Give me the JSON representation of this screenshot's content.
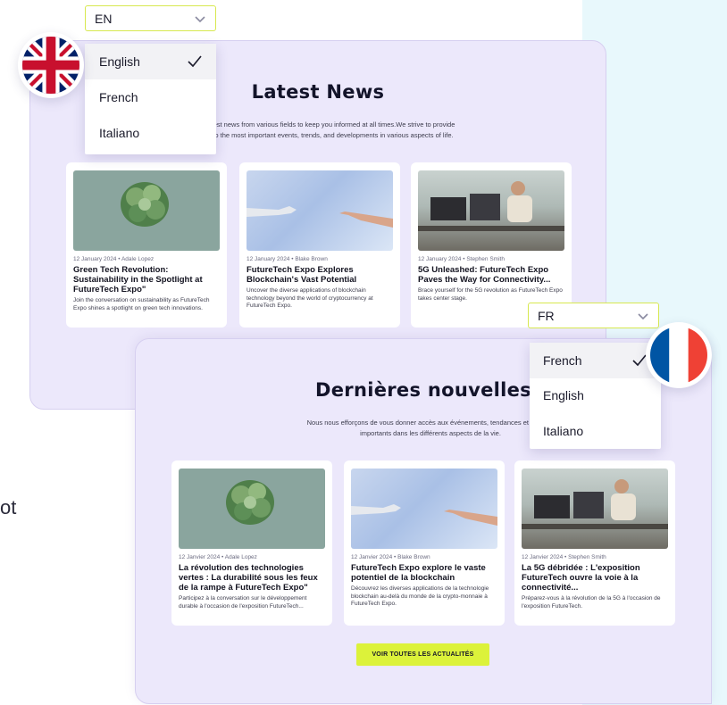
{
  "colors": {
    "accent": "#dcf23a",
    "panel_bg": "#ece8fb",
    "select_border": "#d7e84f",
    "uk_blue": "#012169",
    "uk_red": "#C8102E",
    "fr_blue": "#0055A4",
    "fr_red": "#EF4135"
  },
  "side_text": "ot",
  "en": {
    "select_value": "EN",
    "options": [
      {
        "label": "English",
        "selected": true
      },
      {
        "label": "French",
        "selected": false
      },
      {
        "label": "Italiano",
        "selected": false
      }
    ],
    "title": "Latest News",
    "intro_line1": "est news from various fields to keep you informed at all times.We strive to provide",
    "intro_line2": "o the most important events, trends, and developments in various aspects of life.",
    "cards": [
      {
        "meta": "12 January 2024 • Adale Lopez",
        "title": "Green Tech Revolution: Sustainability in the Spotlight at FutureTech Expo\"",
        "desc": "Join the conversation on sustainability as FutureTech Expo shines a spotlight on green tech innovations.",
        "image": "plant-image"
      },
      {
        "meta": "12 January 2024 • Blake Brown",
        "title": "FutureTech Expo Explores Blockchain's Vast Potential",
        "desc": "Uncover the diverse applications of blockchain technology beyond the world of cryptocurrency at FutureTech Expo.",
        "image": "hands-image"
      },
      {
        "meta": "12 January 2024 • Stephen Smith",
        "title": "5G Unleashed: FutureTech Expo Paves the Way for Connectivity...",
        "desc": "Brace yourself for the 5G revolution as FutureTech Expo takes center stage.",
        "image": "office-image"
      }
    ]
  },
  "fr": {
    "select_value": "FR",
    "options": [
      {
        "label": "French",
        "selected": true
      },
      {
        "label": "English",
        "selected": false
      },
      {
        "label": "Italiano",
        "selected": false
      }
    ],
    "title": "Dernières nouvelles",
    "intro_line1": "Nous nous efforçons de vous donner accès aux événements, tendances et dévelop",
    "intro_line2": "importants dans les différents aspects de la vie.",
    "cards": [
      {
        "meta": "12 Janvier 2024 • Adale Lopez",
        "title": "La révolution des technologies vertes : La durabilité sous les feux de la rampe à FutureTech Expo\"",
        "desc": "Participez à la conversation sur le développement durable à l'occasion de l'exposition FutureTech...",
        "image": "plant-image"
      },
      {
        "meta": "12 Janvier 2024 • Blake Brown",
        "title": "FutureTech Expo explore le vaste potentiel de la blockchain",
        "desc": "Découvrez les diverses applications de la technologie blockchain au-delà du monde de la crypto-monnaie à FutureTech Expo.",
        "image": "hands-image"
      },
      {
        "meta": "12 Janvier 2024 • Stephen Smith",
        "title": "La 5G débridée : L'exposition FutureTech ouvre la voie à la connectivité...",
        "desc": "Préparez-vous à la révolution de la 5G à l'occasion de l'exposition FutureTech.",
        "image": "office-image"
      }
    ],
    "cta_label": "VOIR TOUTES LES ACTUALITÉS"
  }
}
